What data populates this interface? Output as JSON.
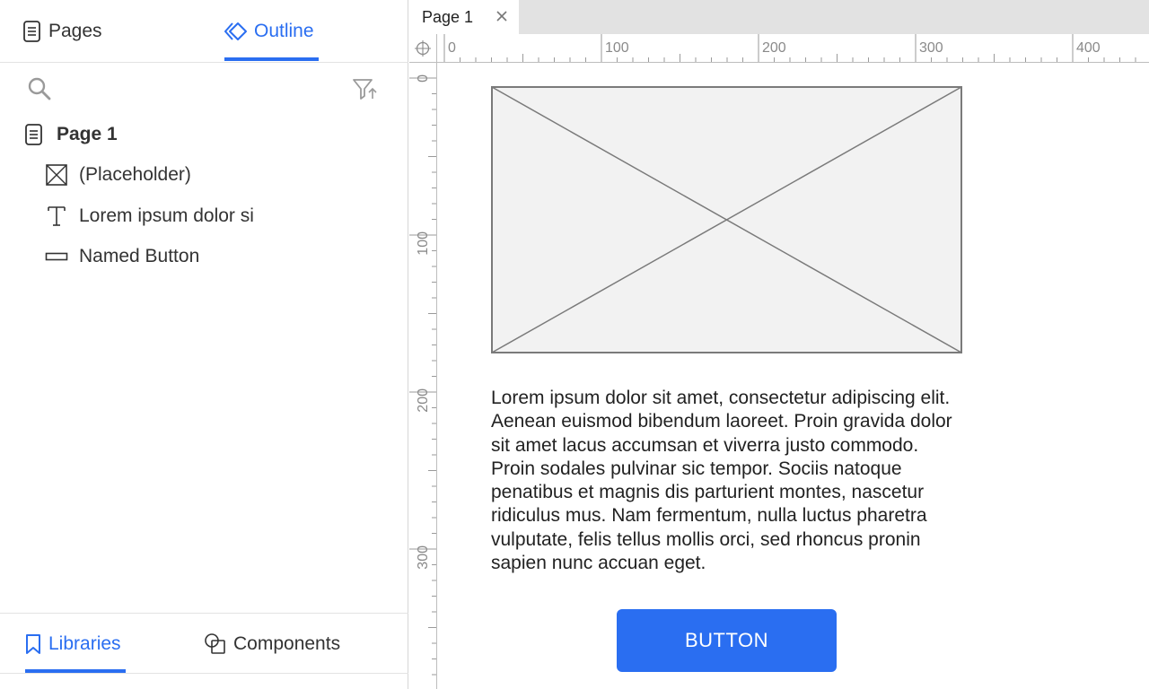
{
  "left_panel": {
    "tabs": {
      "pages_label": "Pages",
      "outline_label": "Outline",
      "active": "Outline"
    },
    "tree": {
      "page": "Page 1",
      "items": [
        {
          "label": "(Placeholder)",
          "icon": "placeholder-icon"
        },
        {
          "label": "Lorem ipsum dolor si",
          "icon": "text-icon"
        },
        {
          "label": "Named Button",
          "icon": "button-icon"
        }
      ]
    },
    "bottom_tabs": {
      "libraries_label": "Libraries",
      "components_label": "Components",
      "active": "Libraries"
    }
  },
  "document_tab": {
    "title": "Page 1"
  },
  "rulers": {
    "horizontal": [
      "0",
      "100",
      "200",
      "300",
      "400"
    ],
    "vertical": [
      "0",
      "100",
      "200",
      "300"
    ]
  },
  "canvas": {
    "paragraph": "Lorem ipsum dolor sit amet, consectetur adipiscing elit. Aenean euismod bibendum laoreet. Proin gravida dolor sit amet lacus accumsan et viverra justo commodo. Proin sodales pulvinar sic tempor. Sociis natoque penatibus et magnis dis parturient montes, nascetur ridiculus mus. Nam fermentum, nulla luctus pharetra vulputate, felis tellus mollis orci, sed rhoncus pronin sapien nunc accuan eget.",
    "button_label": "BUTTON"
  },
  "colors": {
    "accent": "#2a6ef1",
    "placeholder_fill": "#f2f2f2",
    "placeholder_stroke": "#7a7a7a"
  }
}
